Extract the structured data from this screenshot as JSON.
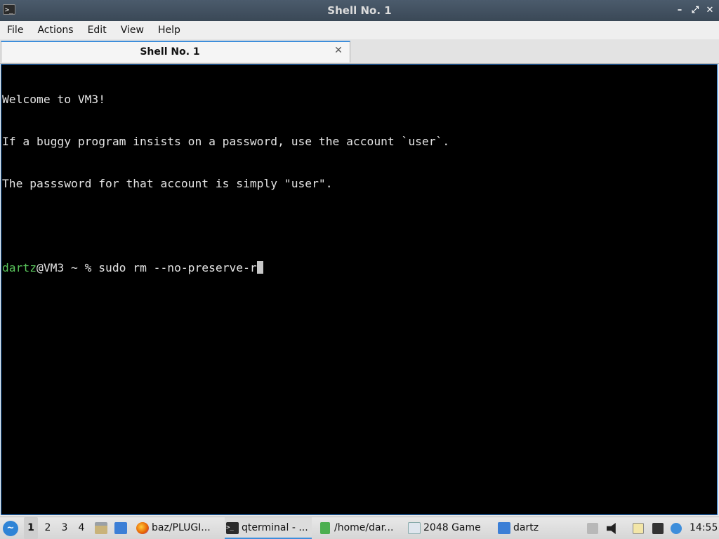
{
  "window": {
    "title": "Shell No. 1",
    "app_icon": "terminal-icon",
    "controls": {
      "minimize": "–",
      "restore": "⤢",
      "close": "✕"
    }
  },
  "menu": [
    "File",
    "Actions",
    "Edit",
    "View",
    "Help"
  ],
  "tabs": [
    {
      "label": "Shell No. 1",
      "close": "✕"
    }
  ],
  "terminal": {
    "lines": [
      "Welcome to VM3!",
      "If a buggy program insists on a password, use the account `user`.",
      "The passsword for that account is simply \"user\".",
      ""
    ],
    "prompt": {
      "user": "dartz",
      "host_suffix": "@VM3 ~ % ",
      "command": "sudo rm --no-preserve-r"
    }
  },
  "taskbar": {
    "start_icon": "lxqt-start-icon",
    "desktops": [
      "1",
      "2",
      "3",
      "4"
    ],
    "active_desktop": "1",
    "quicklaunch": [
      "file-manager-icon",
      "show-desktop-icon"
    ],
    "tasks": [
      {
        "label": "baz/PLUGI...",
        "icon": "firefox-icon"
      },
      {
        "label": "qterminal - ...",
        "icon": "terminal-icon",
        "active": true
      },
      {
        "label": "/home/dar...",
        "icon": "text-editor-icon"
      },
      {
        "label": "2048 Game",
        "icon": "window-icon"
      },
      {
        "label": "dartz",
        "icon": "folder-icon"
      }
    ],
    "tray": [
      "upload-icon",
      "volume-icon",
      "clipboard-icon",
      "network-icon",
      "update-icon"
    ],
    "clock": "14:55"
  },
  "colors": {
    "accent": "#3d8edb",
    "prompt_user": "#58c25a",
    "terminal_bg": "#000000",
    "terminal_fg": "#e4e4e4"
  }
}
